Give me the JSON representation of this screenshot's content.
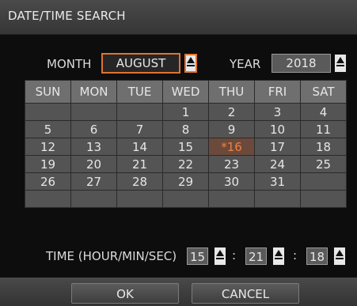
{
  "dialog": {
    "title": "DATE/TIME SEARCH"
  },
  "month": {
    "label": "MONTH",
    "value": "AUGUST"
  },
  "year": {
    "label": "YEAR",
    "value": "2018"
  },
  "calendar": {
    "weekdays": [
      "SUN",
      "MON",
      "TUE",
      "WED",
      "THU",
      "FRI",
      "SAT"
    ],
    "weeks": [
      [
        "",
        "",
        "",
        "1",
        "2",
        "3",
        "4"
      ],
      [
        "5",
        "6",
        "7",
        "8",
        "9",
        "10",
        "11"
      ],
      [
        "12",
        "13",
        "14",
        "15",
        "*16",
        "17",
        "18"
      ],
      [
        "19",
        "20",
        "21",
        "22",
        "23",
        "24",
        "25"
      ],
      [
        "26",
        "27",
        "28",
        "29",
        "30",
        "31",
        ""
      ],
      [
        "",
        "",
        "",
        "",
        "",
        "",
        ""
      ]
    ],
    "highlight_color": "#ef8040"
  },
  "time": {
    "label": "TIME (HOUR/MIN/SEC)",
    "hour": "15",
    "minute": "21",
    "second": "18",
    "separator": ":"
  },
  "buttons": {
    "ok": "OK",
    "cancel": "CANCEL"
  },
  "colors": {
    "focus": "#e0742f",
    "cell": "#545454",
    "header_cell": "#6f6f6f"
  },
  "icons": {
    "spinner": "triangle-up-icon"
  }
}
